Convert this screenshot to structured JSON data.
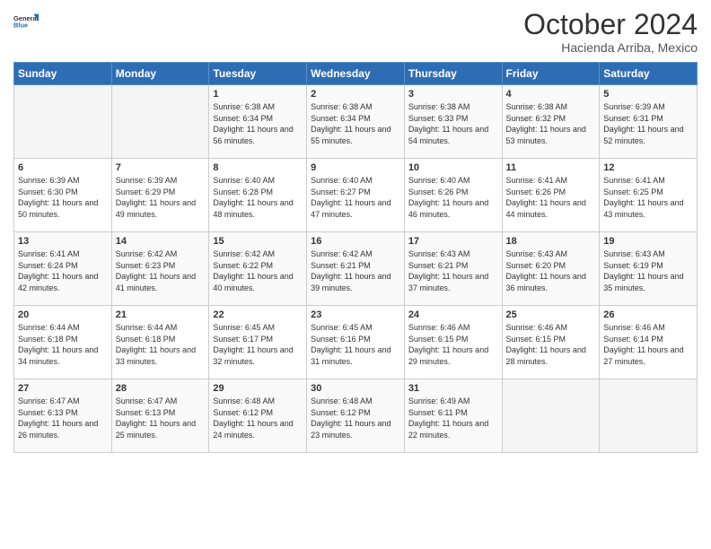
{
  "header": {
    "logo_general": "General",
    "logo_blue": "Blue",
    "month_title": "October 2024",
    "location": "Hacienda Arriba, Mexico"
  },
  "days_of_week": [
    "Sunday",
    "Monday",
    "Tuesday",
    "Wednesday",
    "Thursday",
    "Friday",
    "Saturday"
  ],
  "weeks": [
    [
      {
        "day": "",
        "info": ""
      },
      {
        "day": "",
        "info": ""
      },
      {
        "day": "1",
        "info": "Sunrise: 6:38 AM\nSunset: 6:34 PM\nDaylight: 11 hours and 56 minutes."
      },
      {
        "day": "2",
        "info": "Sunrise: 6:38 AM\nSunset: 6:34 PM\nDaylight: 11 hours and 55 minutes."
      },
      {
        "day": "3",
        "info": "Sunrise: 6:38 AM\nSunset: 6:33 PM\nDaylight: 11 hours and 54 minutes."
      },
      {
        "day": "4",
        "info": "Sunrise: 6:38 AM\nSunset: 6:32 PM\nDaylight: 11 hours and 53 minutes."
      },
      {
        "day": "5",
        "info": "Sunrise: 6:39 AM\nSunset: 6:31 PM\nDaylight: 11 hours and 52 minutes."
      }
    ],
    [
      {
        "day": "6",
        "info": "Sunrise: 6:39 AM\nSunset: 6:30 PM\nDaylight: 11 hours and 50 minutes."
      },
      {
        "day": "7",
        "info": "Sunrise: 6:39 AM\nSunset: 6:29 PM\nDaylight: 11 hours and 49 minutes."
      },
      {
        "day": "8",
        "info": "Sunrise: 6:40 AM\nSunset: 6:28 PM\nDaylight: 11 hours and 48 minutes."
      },
      {
        "day": "9",
        "info": "Sunrise: 6:40 AM\nSunset: 6:27 PM\nDaylight: 11 hours and 47 minutes."
      },
      {
        "day": "10",
        "info": "Sunrise: 6:40 AM\nSunset: 6:26 PM\nDaylight: 11 hours and 46 minutes."
      },
      {
        "day": "11",
        "info": "Sunrise: 6:41 AM\nSunset: 6:26 PM\nDaylight: 11 hours and 44 minutes."
      },
      {
        "day": "12",
        "info": "Sunrise: 6:41 AM\nSunset: 6:25 PM\nDaylight: 11 hours and 43 minutes."
      }
    ],
    [
      {
        "day": "13",
        "info": "Sunrise: 6:41 AM\nSunset: 6:24 PM\nDaylight: 11 hours and 42 minutes."
      },
      {
        "day": "14",
        "info": "Sunrise: 6:42 AM\nSunset: 6:23 PM\nDaylight: 11 hours and 41 minutes."
      },
      {
        "day": "15",
        "info": "Sunrise: 6:42 AM\nSunset: 6:22 PM\nDaylight: 11 hours and 40 minutes."
      },
      {
        "day": "16",
        "info": "Sunrise: 6:42 AM\nSunset: 6:21 PM\nDaylight: 11 hours and 39 minutes."
      },
      {
        "day": "17",
        "info": "Sunrise: 6:43 AM\nSunset: 6:21 PM\nDaylight: 11 hours and 37 minutes."
      },
      {
        "day": "18",
        "info": "Sunrise: 6:43 AM\nSunset: 6:20 PM\nDaylight: 11 hours and 36 minutes."
      },
      {
        "day": "19",
        "info": "Sunrise: 6:43 AM\nSunset: 6:19 PM\nDaylight: 11 hours and 35 minutes."
      }
    ],
    [
      {
        "day": "20",
        "info": "Sunrise: 6:44 AM\nSunset: 6:18 PM\nDaylight: 11 hours and 34 minutes."
      },
      {
        "day": "21",
        "info": "Sunrise: 6:44 AM\nSunset: 6:18 PM\nDaylight: 11 hours and 33 minutes."
      },
      {
        "day": "22",
        "info": "Sunrise: 6:45 AM\nSunset: 6:17 PM\nDaylight: 11 hours and 32 minutes."
      },
      {
        "day": "23",
        "info": "Sunrise: 6:45 AM\nSunset: 6:16 PM\nDaylight: 11 hours and 31 minutes."
      },
      {
        "day": "24",
        "info": "Sunrise: 6:46 AM\nSunset: 6:15 PM\nDaylight: 11 hours and 29 minutes."
      },
      {
        "day": "25",
        "info": "Sunrise: 6:46 AM\nSunset: 6:15 PM\nDaylight: 11 hours and 28 minutes."
      },
      {
        "day": "26",
        "info": "Sunrise: 6:46 AM\nSunset: 6:14 PM\nDaylight: 11 hours and 27 minutes."
      }
    ],
    [
      {
        "day": "27",
        "info": "Sunrise: 6:47 AM\nSunset: 6:13 PM\nDaylight: 11 hours and 26 minutes."
      },
      {
        "day": "28",
        "info": "Sunrise: 6:47 AM\nSunset: 6:13 PM\nDaylight: 11 hours and 25 minutes."
      },
      {
        "day": "29",
        "info": "Sunrise: 6:48 AM\nSunset: 6:12 PM\nDaylight: 11 hours and 24 minutes."
      },
      {
        "day": "30",
        "info": "Sunrise: 6:48 AM\nSunset: 6:12 PM\nDaylight: 11 hours and 23 minutes."
      },
      {
        "day": "31",
        "info": "Sunrise: 6:49 AM\nSunset: 6:11 PM\nDaylight: 11 hours and 22 minutes."
      },
      {
        "day": "",
        "info": ""
      },
      {
        "day": "",
        "info": ""
      }
    ]
  ]
}
